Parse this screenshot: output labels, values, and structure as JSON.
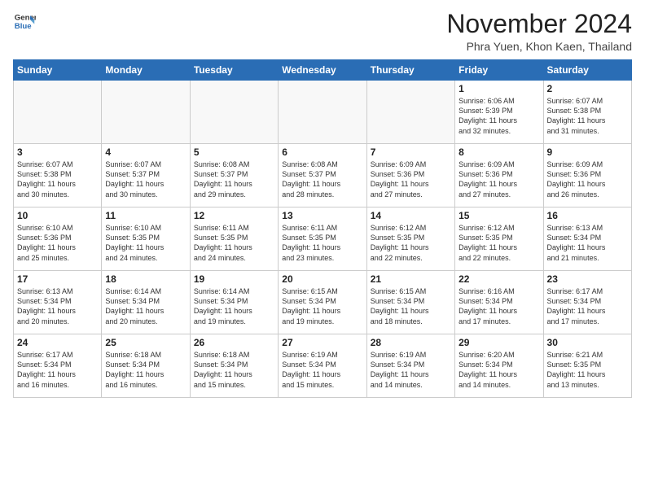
{
  "logo": {
    "line1": "General",
    "line2": "Blue"
  },
  "header": {
    "month_title": "November 2024",
    "subtitle": "Phra Yuen, Khon Kaen, Thailand"
  },
  "weekdays": [
    "Sunday",
    "Monday",
    "Tuesday",
    "Wednesday",
    "Thursday",
    "Friday",
    "Saturday"
  ],
  "weeks": [
    [
      {
        "day": "",
        "info": ""
      },
      {
        "day": "",
        "info": ""
      },
      {
        "day": "",
        "info": ""
      },
      {
        "day": "",
        "info": ""
      },
      {
        "day": "",
        "info": ""
      },
      {
        "day": "1",
        "info": "Sunrise: 6:06 AM\nSunset: 5:39 PM\nDaylight: 11 hours\nand 32 minutes."
      },
      {
        "day": "2",
        "info": "Sunrise: 6:07 AM\nSunset: 5:38 PM\nDaylight: 11 hours\nand 31 minutes."
      }
    ],
    [
      {
        "day": "3",
        "info": "Sunrise: 6:07 AM\nSunset: 5:38 PM\nDaylight: 11 hours\nand 30 minutes."
      },
      {
        "day": "4",
        "info": "Sunrise: 6:07 AM\nSunset: 5:37 PM\nDaylight: 11 hours\nand 30 minutes."
      },
      {
        "day": "5",
        "info": "Sunrise: 6:08 AM\nSunset: 5:37 PM\nDaylight: 11 hours\nand 29 minutes."
      },
      {
        "day": "6",
        "info": "Sunrise: 6:08 AM\nSunset: 5:37 PM\nDaylight: 11 hours\nand 28 minutes."
      },
      {
        "day": "7",
        "info": "Sunrise: 6:09 AM\nSunset: 5:36 PM\nDaylight: 11 hours\nand 27 minutes."
      },
      {
        "day": "8",
        "info": "Sunrise: 6:09 AM\nSunset: 5:36 PM\nDaylight: 11 hours\nand 27 minutes."
      },
      {
        "day": "9",
        "info": "Sunrise: 6:09 AM\nSunset: 5:36 PM\nDaylight: 11 hours\nand 26 minutes."
      }
    ],
    [
      {
        "day": "10",
        "info": "Sunrise: 6:10 AM\nSunset: 5:36 PM\nDaylight: 11 hours\nand 25 minutes."
      },
      {
        "day": "11",
        "info": "Sunrise: 6:10 AM\nSunset: 5:35 PM\nDaylight: 11 hours\nand 24 minutes."
      },
      {
        "day": "12",
        "info": "Sunrise: 6:11 AM\nSunset: 5:35 PM\nDaylight: 11 hours\nand 24 minutes."
      },
      {
        "day": "13",
        "info": "Sunrise: 6:11 AM\nSunset: 5:35 PM\nDaylight: 11 hours\nand 23 minutes."
      },
      {
        "day": "14",
        "info": "Sunrise: 6:12 AM\nSunset: 5:35 PM\nDaylight: 11 hours\nand 22 minutes."
      },
      {
        "day": "15",
        "info": "Sunrise: 6:12 AM\nSunset: 5:35 PM\nDaylight: 11 hours\nand 22 minutes."
      },
      {
        "day": "16",
        "info": "Sunrise: 6:13 AM\nSunset: 5:34 PM\nDaylight: 11 hours\nand 21 minutes."
      }
    ],
    [
      {
        "day": "17",
        "info": "Sunrise: 6:13 AM\nSunset: 5:34 PM\nDaylight: 11 hours\nand 20 minutes."
      },
      {
        "day": "18",
        "info": "Sunrise: 6:14 AM\nSunset: 5:34 PM\nDaylight: 11 hours\nand 20 minutes."
      },
      {
        "day": "19",
        "info": "Sunrise: 6:14 AM\nSunset: 5:34 PM\nDaylight: 11 hours\nand 19 minutes."
      },
      {
        "day": "20",
        "info": "Sunrise: 6:15 AM\nSunset: 5:34 PM\nDaylight: 11 hours\nand 19 minutes."
      },
      {
        "day": "21",
        "info": "Sunrise: 6:15 AM\nSunset: 5:34 PM\nDaylight: 11 hours\nand 18 minutes."
      },
      {
        "day": "22",
        "info": "Sunrise: 6:16 AM\nSunset: 5:34 PM\nDaylight: 11 hours\nand 17 minutes."
      },
      {
        "day": "23",
        "info": "Sunrise: 6:17 AM\nSunset: 5:34 PM\nDaylight: 11 hours\nand 17 minutes."
      }
    ],
    [
      {
        "day": "24",
        "info": "Sunrise: 6:17 AM\nSunset: 5:34 PM\nDaylight: 11 hours\nand 16 minutes."
      },
      {
        "day": "25",
        "info": "Sunrise: 6:18 AM\nSunset: 5:34 PM\nDaylight: 11 hours\nand 16 minutes."
      },
      {
        "day": "26",
        "info": "Sunrise: 6:18 AM\nSunset: 5:34 PM\nDaylight: 11 hours\nand 15 minutes."
      },
      {
        "day": "27",
        "info": "Sunrise: 6:19 AM\nSunset: 5:34 PM\nDaylight: 11 hours\nand 15 minutes."
      },
      {
        "day": "28",
        "info": "Sunrise: 6:19 AM\nSunset: 5:34 PM\nDaylight: 11 hours\nand 14 minutes."
      },
      {
        "day": "29",
        "info": "Sunrise: 6:20 AM\nSunset: 5:34 PM\nDaylight: 11 hours\nand 14 minutes."
      },
      {
        "day": "30",
        "info": "Sunrise: 6:21 AM\nSunset: 5:35 PM\nDaylight: 11 hours\nand 13 minutes."
      }
    ]
  ]
}
